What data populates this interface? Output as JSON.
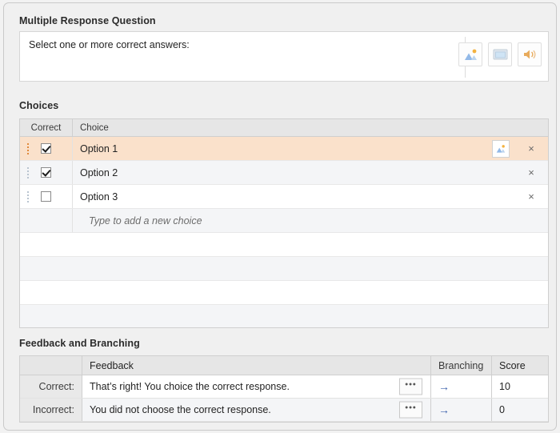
{
  "question_section": {
    "title": "Multiple Response Question",
    "prompt": "Select one or more correct answers:",
    "media_buttons": [
      {
        "name": "image-icon",
        "label": "Insert image"
      },
      {
        "name": "video-icon",
        "label": "Insert video"
      },
      {
        "name": "audio-icon",
        "label": "Insert audio"
      }
    ]
  },
  "choices_section": {
    "title": "Choices",
    "headers": {
      "correct": "Correct",
      "choice": "Choice"
    },
    "rows": [
      {
        "label": "Option 1",
        "checked": true,
        "selected": true,
        "has_image": true,
        "close": "×"
      },
      {
        "label": "Option 2",
        "checked": true,
        "selected": false,
        "has_image": false,
        "close": "×"
      },
      {
        "label": "Option 3",
        "checked": false,
        "selected": false,
        "has_image": false,
        "close": "×"
      }
    ],
    "new_choice_placeholder": "Type to add a new choice",
    "empty_row_count": 4
  },
  "feedback_section": {
    "title": "Feedback and Branching",
    "headers": {
      "label": "",
      "feedback": "Feedback",
      "branching": "Branching",
      "score": "Score"
    },
    "rows": [
      {
        "label": "Correct:",
        "feedback": "That’s right! You choice the correct response.",
        "ellipsis": "•••",
        "branch_arrow": "→",
        "score": "10"
      },
      {
        "label": "Incorrect:",
        "feedback": "You did not choose the correct response.",
        "ellipsis": "•••",
        "branch_arrow": "→",
        "score": "0"
      }
    ]
  },
  "colors": {
    "panel_bg": "#f0f0f0",
    "selected_row": "#fae1cb",
    "accent_orange": "#e08a3c",
    "link_blue": "#3d62ad",
    "header_grey": "#e6e6e6"
  }
}
